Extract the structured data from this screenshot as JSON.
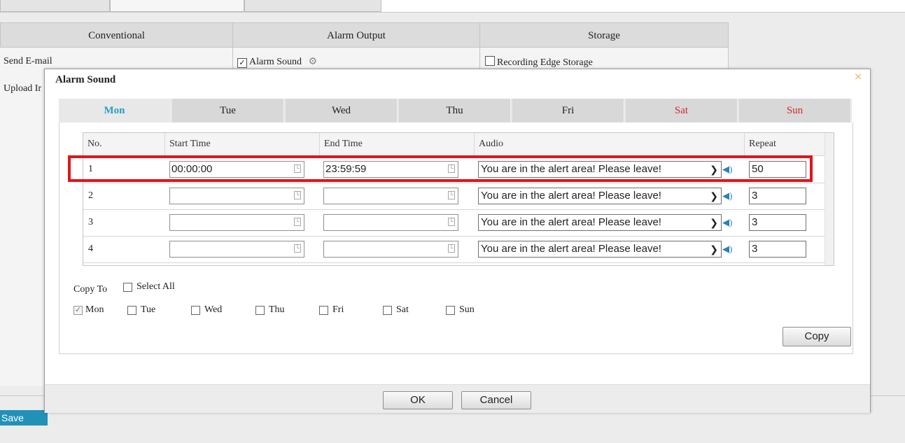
{
  "background": {
    "columns": [
      "Conventional",
      "Alarm Output",
      "Storage"
    ],
    "conventional_items": [
      "Send E-mail",
      "Upload Ir"
    ],
    "alarm_output_item": "Alarm Sound",
    "alarm_sound_checked": "✓",
    "storage_item": "Recording Edge Storage",
    "save_label": "Save"
  },
  "dialog": {
    "title": "Alarm Sound",
    "close": "×",
    "days": [
      {
        "label": "Mon",
        "active": true
      },
      {
        "label": "Tue"
      },
      {
        "label": "Wed"
      },
      {
        "label": "Thu"
      },
      {
        "label": "Fri"
      },
      {
        "label": "Sat",
        "weekend": true
      },
      {
        "label": "Sun",
        "weekend": true
      }
    ],
    "table": {
      "headers": [
        "No.",
        "Start Time",
        "End Time",
        "Audio",
        "Repeat"
      ],
      "rows": [
        {
          "no": "1",
          "start": "00:00:00",
          "end": "23:59:59",
          "audio": "You are in the alert area! Please leave!",
          "repeat": "50"
        },
        {
          "no": "2",
          "start": "",
          "end": "",
          "audio": "You are in the alert area! Please leave!",
          "repeat": "3"
        },
        {
          "no": "3",
          "start": "",
          "end": "",
          "audio": "You are in the alert area! Please leave!",
          "repeat": "3"
        },
        {
          "no": "4",
          "start": "",
          "end": "",
          "audio": "You are in the alert area! Please leave!",
          "repeat": "3"
        }
      ]
    },
    "copy_to": {
      "label": "Copy To",
      "select_all": "Select All",
      "days": [
        {
          "label": "Mon",
          "checked": true
        },
        {
          "label": "Tue",
          "checked": false
        },
        {
          "label": "Wed",
          "checked": false
        },
        {
          "label": "Thu",
          "checked": false
        },
        {
          "label": "Fri",
          "checked": false
        },
        {
          "label": "Sat",
          "checked": false
        },
        {
          "label": "Sun",
          "checked": false
        }
      ],
      "copy_button": "Copy"
    },
    "ok_button": "OK",
    "cancel_button": "Cancel"
  },
  "colors": {
    "active_day": "#2a9ec4",
    "weekend_day": "#d32a2a",
    "highlight": "#e3141b",
    "save_button": "#2291b8",
    "close_icon": "#e8a245"
  },
  "icons": {
    "close": "close-icon",
    "settings": "gear-icon",
    "time_picker": "clock-icon",
    "dropdown": "chevron-down-icon",
    "speaker": "speaker-icon"
  }
}
